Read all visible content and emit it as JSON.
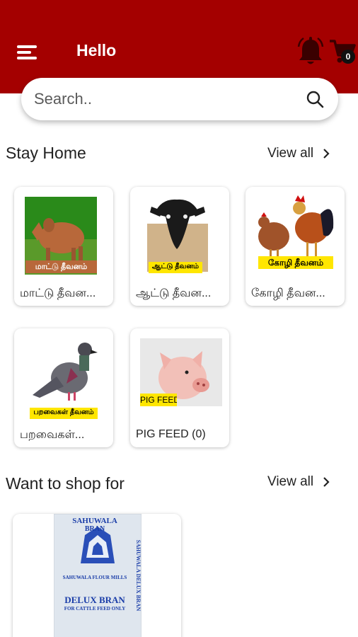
{
  "header": {
    "title": "Hello",
    "cart_count": "0",
    "bar_color": "#a40000",
    "menu_icon": "hamburger-menu-icon",
    "bell_icon": "notification-bell-icon",
    "cart_icon": "shopping-cart-icon"
  },
  "search": {
    "placeholder": "Search..",
    "icon": "search-icon"
  },
  "stay_home": {
    "title": "Stay Home",
    "view_all": "View all",
    "categories": [
      {
        "name": "மாட்டு தீவன...",
        "image_label": "மாட்டு தீவனம்"
      },
      {
        "name": "ஆட்டு தீவன...",
        "image_label": "ஆட்டு தீவனம்"
      },
      {
        "name": "கோழி தீவன...",
        "image_label": "கோழி தீவனம்"
      },
      {
        "name": "பறவைகள்...",
        "image_label": "பறவைகள் தீவனம்"
      },
      {
        "name": "PIG FEED (0)",
        "image_label": "PIG FEED"
      }
    ]
  },
  "want_to_shop": {
    "title": "Want to shop for",
    "view_all": "View all",
    "products": [
      {
        "brand": "SAHUWALA",
        "sub": "BRAN",
        "mill": "SAHUWALA FLOUR MILLS",
        "product": "DELUX BRAN",
        "note": "FOR CATTLE FEED ONLY",
        "side": "SAHUWALA DELUX BRAN"
      }
    ]
  }
}
